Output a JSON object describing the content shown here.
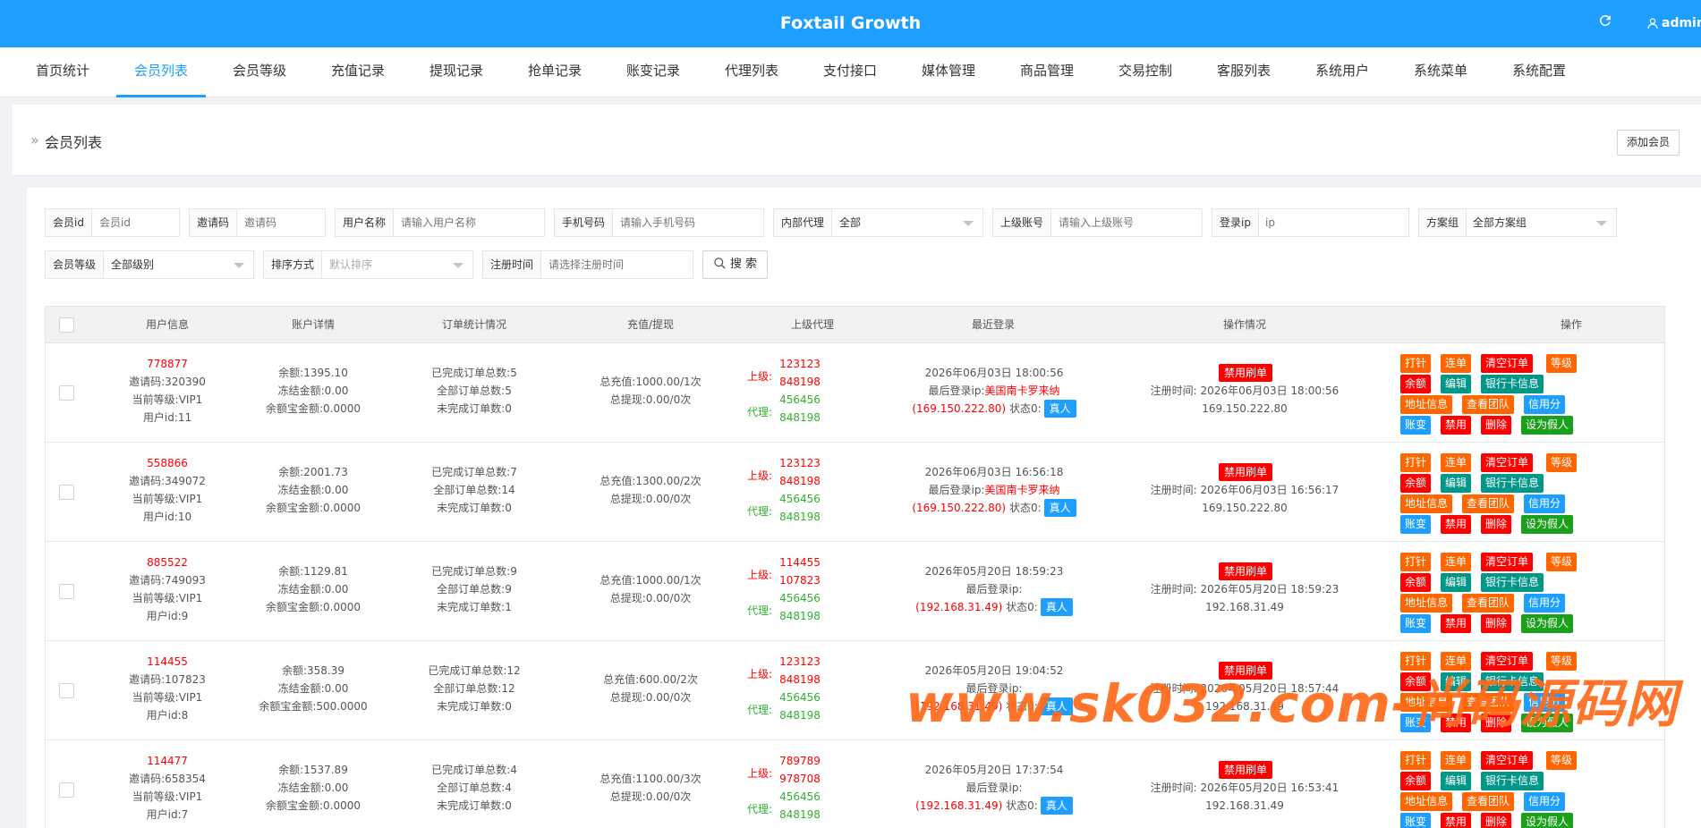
{
  "app": {
    "title": "Foxtail Growth",
    "user": "admin"
  },
  "nav": {
    "tabs": [
      {
        "label": "首页统计"
      },
      {
        "label": "会员列表"
      },
      {
        "label": "会员等级"
      },
      {
        "label": "充值记录"
      },
      {
        "label": "提现记录"
      },
      {
        "label": "抢单记录"
      },
      {
        "label": "账变记录"
      },
      {
        "label": "代理列表"
      },
      {
        "label": "支付接口"
      },
      {
        "label": "媒体管理"
      },
      {
        "label": "商品管理"
      },
      {
        "label": "交易控制"
      },
      {
        "label": "客服列表"
      },
      {
        "label": "系统用户"
      },
      {
        "label": "系统菜单"
      },
      {
        "label": "系统配置"
      }
    ],
    "active": "会员列表"
  },
  "page": {
    "title": "会员列表",
    "add_button": "添加会员"
  },
  "filters": {
    "member_id": {
      "label": "会员id",
      "placeholder": "会员id"
    },
    "invite_code": {
      "label": "邀请码",
      "placeholder": "邀请码"
    },
    "username": {
      "label": "用户名称",
      "placeholder": "请输入用户名称"
    },
    "phone": {
      "label": "手机号码",
      "placeholder": "请输入手机号码"
    },
    "inner_agent": {
      "label": "内部代理",
      "value": "全部"
    },
    "parent_account": {
      "label": "上级账号",
      "placeholder": "请输入上级账号"
    },
    "login_ip": {
      "label": "登录ip",
      "placeholder": "ip"
    },
    "plan_group": {
      "label": "方案组",
      "value": "全部方案组"
    },
    "member_level": {
      "label": "会员等级",
      "value": "全部级别"
    },
    "sort": {
      "label": "排序方式",
      "value": "默认排序"
    },
    "reg_time": {
      "label": "注册时间",
      "placeholder": "请选择注册时间"
    },
    "search_button": "搜 索"
  },
  "table": {
    "headers": {
      "user": "用户信息",
      "account": "账户详情",
      "orders": "订单统计情况",
      "recharge": "充值/提现",
      "parent": "上级代理",
      "login": "最近登录",
      "status": "操作情况",
      "ops": "操作"
    },
    "labels": {
      "up": "上级:",
      "agent": "代理:",
      "real": "真人",
      "ban": "禁用刷单"
    },
    "action_labels": {
      "pin": "打针",
      "chain": "连单",
      "clear": "清空订单",
      "level": "等级",
      "balance": "余额",
      "edit": "编辑",
      "bank": "银行卡信息",
      "address": "地址信息",
      "team": "查看团队",
      "credit": "信用分",
      "change": "账变",
      "disable": "禁用",
      "delete": "删除",
      "fake": "设为假人"
    },
    "rows": [
      {
        "uid": "778877",
        "invite": "邀请码:320390",
        "level": "当前等级:VIP1",
        "userid": "用户id:11",
        "balance": "余额:1395.10",
        "frozen": "冻结金额:0.00",
        "yeb": "余额宝金额:0.0000",
        "done": "已完成订单总数:5",
        "total": "全部订单总数:5",
        "undone": "未完成订单数:0",
        "recharge": "总充值:1000.00/1次",
        "withdraw": "总提现:0.00/0次",
        "up1": "123123",
        "up2": "848198",
        "ag1": "456456",
        "ag2": "848198",
        "login_time": "2026年06月03日 18:00:56",
        "login_ip_label": "最后登录ip:",
        "login_loc": "美国南卡罗来纳",
        "login_ip": "(169.150.222.80)",
        "state": "状态0:",
        "reg_time": "注册时间:  2026年06月03日 18:00:56",
        "reg_ip": "169.150.222.80"
      },
      {
        "uid": "558866",
        "invite": "邀请码:349072",
        "level": "当前等级:VIP1",
        "userid": "用户id:10",
        "balance": "余额:2001.73",
        "frozen": "冻结金额:0.00",
        "yeb": "余额宝金额:0.0000",
        "done": "已完成订单总数:7",
        "total": "全部订单总数:14",
        "undone": "未完成订单数:0",
        "recharge": "总充值:1300.00/2次",
        "withdraw": "总提现:0.00/0次",
        "up1": "123123",
        "up2": "848198",
        "ag1": "456456",
        "ag2": "848198",
        "login_time": "2026年06月03日 16:56:18",
        "login_ip_label": "最后登录ip:",
        "login_loc": "美国南卡罗来纳",
        "login_ip": "(169.150.222.80)",
        "state": "状态0:",
        "reg_time": "注册时间:  2026年06月03日 16:56:17",
        "reg_ip": "169.150.222.80"
      },
      {
        "uid": "885522",
        "invite": "邀请码:749093",
        "level": "当前等级:VIP1",
        "userid": "用户id:9",
        "balance": "余额:1129.81",
        "frozen": "冻结金额:0.00",
        "yeb": "余额宝金额:0.0000",
        "done": "已完成订单总数:9",
        "total": "全部订单总数:9",
        "undone": "未完成订单数:1",
        "recharge": "总充值:1000.00/1次",
        "withdraw": "总提现:0.00/0次",
        "up1": "114455",
        "up2": "107823",
        "ag1": "456456",
        "ag2": "848198",
        "login_time": "2026年05月20日 18:59:23",
        "login_ip_label": "最后登录ip:",
        "login_loc": "",
        "login_ip": "(192.168.31.49)",
        "state": "状态0:",
        "reg_time": "注册时间:  2026年05月20日 18:59:23",
        "reg_ip": "192.168.31.49"
      },
      {
        "uid": "114455",
        "invite": "邀请码:107823",
        "level": "当前等级:VIP1",
        "userid": "用户id:8",
        "balance": "余额:358.39",
        "frozen": "冻结金额:0.00",
        "yeb": "余额宝金额:500.0000",
        "done": "已完成订单总数:12",
        "total": "全部订单总数:12",
        "undone": "未完成订单数:0",
        "recharge": "总充值:600.00/2次",
        "withdraw": "总提现:0.00/0次",
        "up1": "123123",
        "up2": "848198",
        "ag1": "456456",
        "ag2": "848198",
        "login_time": "2026年05月20日 19:04:52",
        "login_ip_label": "最后登录ip:",
        "login_loc": "",
        "login_ip": "(192.168.31.49)",
        "state": "状态0:",
        "reg_time": "注册时间:  2026年05月20日 18:57:44",
        "reg_ip": "192.168.31.49"
      },
      {
        "uid": "114477",
        "invite": "邀请码:658354",
        "level": "当前等级:VIP1",
        "userid": "用户id:7",
        "balance": "余额:1537.89",
        "frozen": "冻结金额:0.00",
        "yeb": "余额宝金额:0.0000",
        "done": "已完成订单总数:4",
        "total": "全部订单总数:4",
        "undone": "未完成订单数:0",
        "recharge": "总充值:1100.00/3次",
        "withdraw": "总提现:0.00/0次",
        "up1": "789789",
        "up2": "978708",
        "ag1": "456456",
        "ag2": "848198",
        "login_time": "2026年05月20日 17:37:54",
        "login_ip_label": "最后登录ip:",
        "login_loc": "",
        "login_ip": "(192.168.31.49)",
        "state": "状态0:",
        "reg_time": "注册时间:  2026年05月20日 16:53:41",
        "reg_ip": "192.168.31.49"
      }
    ]
  },
  "watermark": "www.sk032.com-尚码源码网",
  "colors": {
    "primary": "#1e9fff",
    "orange": "#ff6600",
    "red": "#ff0000",
    "teal": "#009688",
    "green": "#1aa01a"
  }
}
